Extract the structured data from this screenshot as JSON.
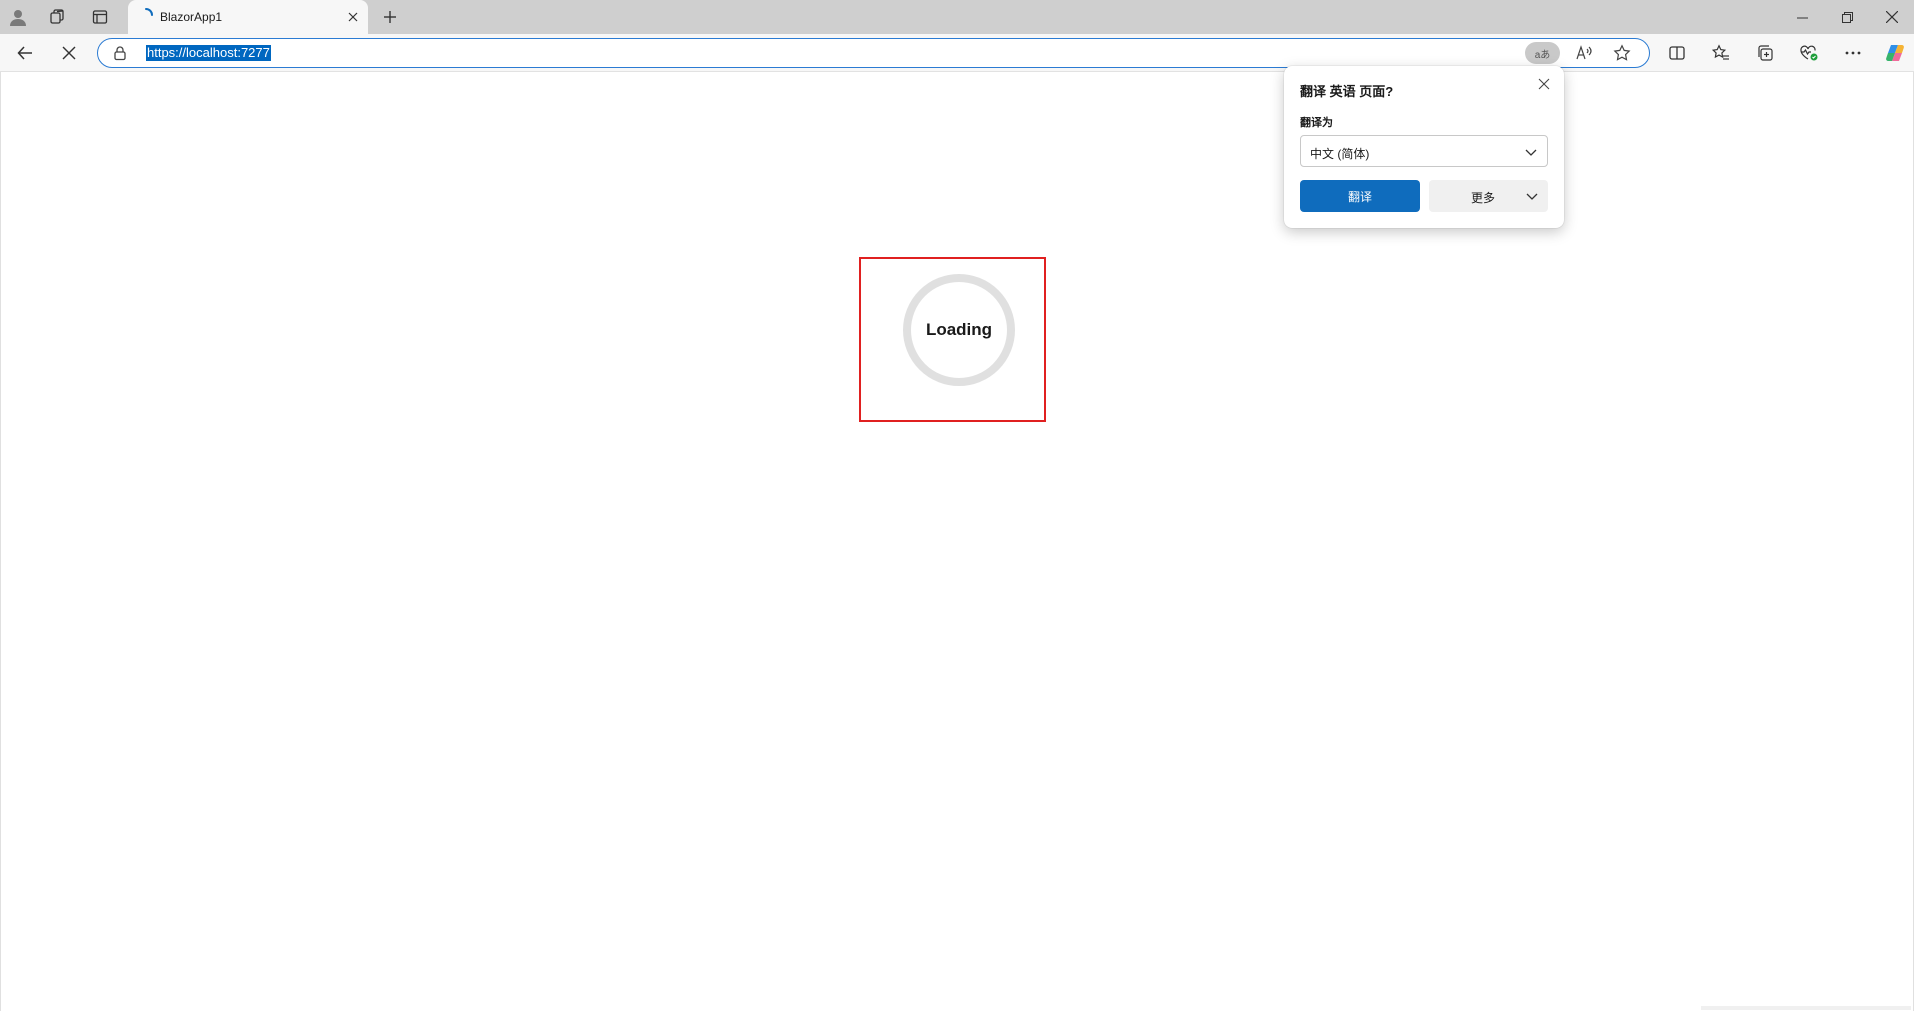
{
  "browser": {
    "tab": {
      "title": "BlazorApp1"
    },
    "address_bar": {
      "url": "https://localhost:7277",
      "translate_badge": "aあ"
    }
  },
  "page": {
    "loading_text": "Loading"
  },
  "translate_popup": {
    "title": "翻译 英语 页面?",
    "target_label": "翻译为",
    "target_language": "中文 (简体)",
    "translate_button": "翻译",
    "more_button": "更多"
  },
  "colors": {
    "accent": "#0f6cbd",
    "highlight_frame": "#e02020",
    "url_selection": "#0067c0"
  },
  "icons": {
    "tabbar": [
      "profile-icon",
      "workspaces-icon",
      "tab-actions-icon"
    ],
    "toolbar_right": [
      "split-screen-icon",
      "favorites-icon",
      "collections-icon",
      "browser-essentials-icon",
      "more-icon",
      "copilot-icon"
    ]
  }
}
